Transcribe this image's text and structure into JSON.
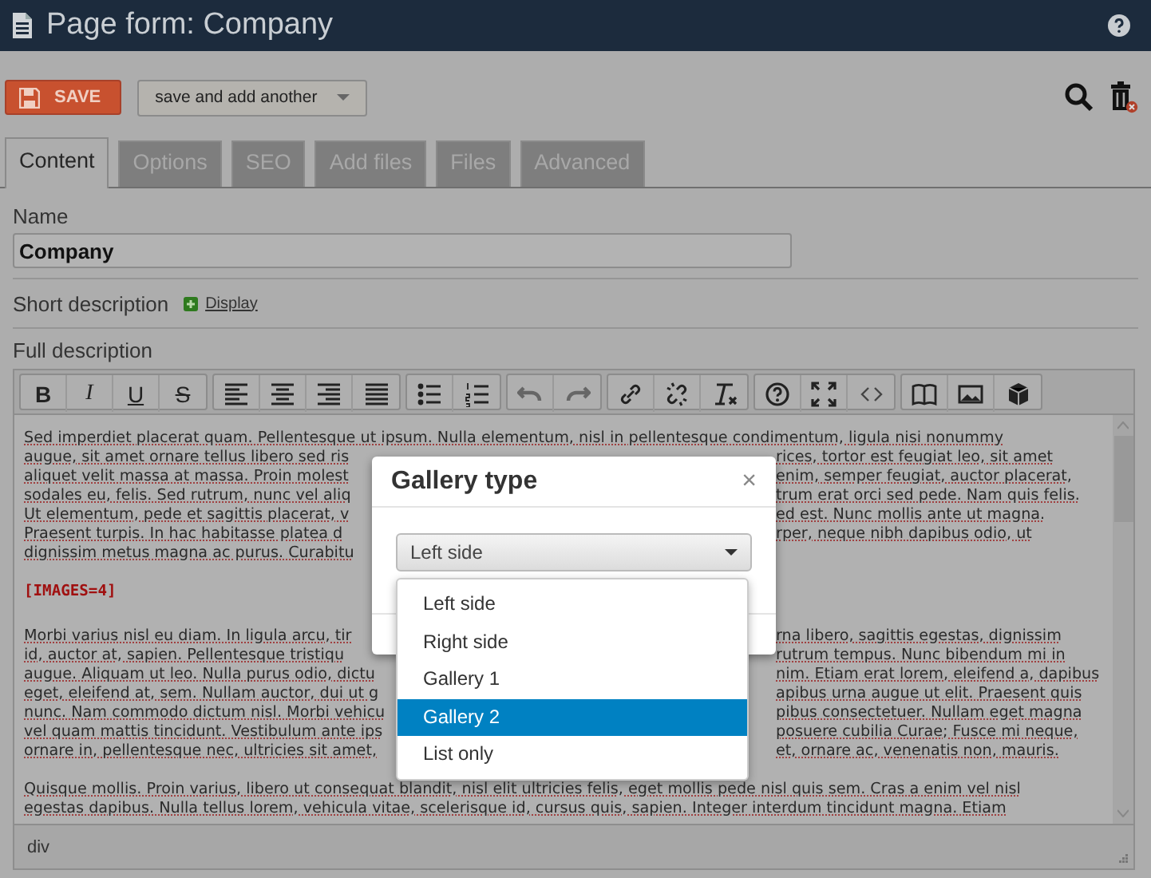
{
  "header": {
    "title": "Page form: Company"
  },
  "actions": {
    "save": "SAVE",
    "save_another": "save and add another"
  },
  "tabs": [
    {
      "label": "Content",
      "selected": true
    },
    {
      "label": "Options",
      "selected": false
    },
    {
      "label": "SEO",
      "selected": false
    },
    {
      "label": "Add files",
      "selected": false
    },
    {
      "label": "Files",
      "selected": false
    },
    {
      "label": "Advanced",
      "selected": false
    }
  ],
  "fields": {
    "name": {
      "label": "Name",
      "value": "Company"
    },
    "short_description": {
      "label": "Short description",
      "link": "Display"
    },
    "full_description": {
      "label": "Full description"
    }
  },
  "editor": {
    "toolbar": [
      [
        {
          "kind": "bold",
          "label": "B"
        },
        {
          "kind": "italic",
          "label": "I"
        },
        {
          "kind": "underline",
          "label": "U"
        },
        {
          "kind": "strike",
          "label": "S"
        }
      ],
      [
        {
          "kind": "align-left"
        },
        {
          "kind": "align-center"
        },
        {
          "kind": "align-right"
        },
        {
          "kind": "justify"
        }
      ],
      [
        {
          "kind": "bullets"
        },
        {
          "kind": "numbers"
        }
      ],
      [
        {
          "kind": "undo"
        },
        {
          "kind": "redo"
        }
      ],
      [
        {
          "kind": "link"
        },
        {
          "kind": "unlink"
        },
        {
          "kind": "clear-format"
        }
      ],
      [
        {
          "kind": "help"
        },
        {
          "kind": "maximize"
        },
        {
          "kind": "source"
        }
      ],
      [
        {
          "kind": "book"
        },
        {
          "kind": "image"
        },
        {
          "kind": "cube"
        }
      ]
    ],
    "paragraphs": [
      {
        "kind": "text",
        "lines": [
          {
            "left": "Sed imperdiet placerat quam. Pellentesque ut ipsum. Nulla elementum, nisl in pellentesque condimentum, ligula nisi nonummy"
          },
          {
            "left": "augue, sit amet ornare tellus libero sed ris",
            "right": "rices, tortor est feugiat leo, sit amet"
          },
          {
            "left": "aliquet velit massa at massa. Proin molest",
            "right": "enim, semper feugiat, auctor placerat,"
          },
          {
            "left": "sodales eu, felis. Sed rutrum, nunc vel aliq",
            "right": "trum erat orci sed pede. Nam quis felis."
          },
          {
            "left": "Ut elementum, pede et sagittis placerat, v",
            "right": "ed est. Nunc mollis ante ut magna."
          },
          {
            "left": "Praesent turpis. In hac habitasse platea d",
            "right": "rper, neque nibh dapibus odio, ut"
          },
          {
            "left": "dignissim metus magna ac purus. Curabitu"
          }
        ]
      },
      {
        "kind": "tag",
        "text": "[IMAGES=4]"
      },
      {
        "kind": "text",
        "lines": [
          {
            "left": "Morbi varius nisl eu diam. In ligula arcu, tir",
            "right": "rna libero, sagittis egestas, dignissim"
          },
          {
            "left": "id, auctor at, sapien. Pellentesque tristiqu",
            "right": "rutrum tempus. Nunc bibendum mi in"
          },
          {
            "left": "augue. Aliquam ut leo. Nulla purus odio, dictu",
            "right": "nim. Etiam erat lorem, eleifend a, dapibus"
          },
          {
            "left": "eget, eleifend at, sem. Nullam auctor, dui ut g",
            "right": "apibus urna augue ut elit. Praesent quis"
          },
          {
            "left": "nunc. Nam commodo dictum nisl. Morbi vehicu",
            "right": "pibus consectetuer. Nullam eget magna"
          },
          {
            "left": "vel quam mattis tincidunt. Vestibulum ante ips",
            "right": "posuere cubilia Curae; Fusce mi neque,"
          },
          {
            "left": "ornare in, pellentesque nec, ultricies sit amet,",
            "right": "et, ornare ac, venenatis non, mauris."
          }
        ]
      },
      {
        "kind": "text",
        "lines": [
          {
            "left": "Quisque mollis. Proin varius, libero ut consequat blandit, nisl elit ultricies felis, eget mollis pede nisl quis sem. Cras a enim vel nisl"
          },
          {
            "left": "egestas dapibus. Nulla tellus lorem, vehicula vitae, scelerisque id, cursus quis, sapien. Integer interdum tincidunt magna. Etiam"
          }
        ]
      }
    ],
    "status": "div"
  },
  "dialog": {
    "title": "Gallery type",
    "close": "×",
    "select": {
      "value": "Left side",
      "options": [
        {
          "label": "Left side",
          "highlighted": false
        },
        {
          "label": "Right side",
          "highlighted": false
        },
        {
          "label": "Gallery 1",
          "highlighted": false
        },
        {
          "label": "Gallery 2",
          "highlighted": true
        },
        {
          "label": "List only",
          "highlighted": false
        }
      ]
    }
  }
}
